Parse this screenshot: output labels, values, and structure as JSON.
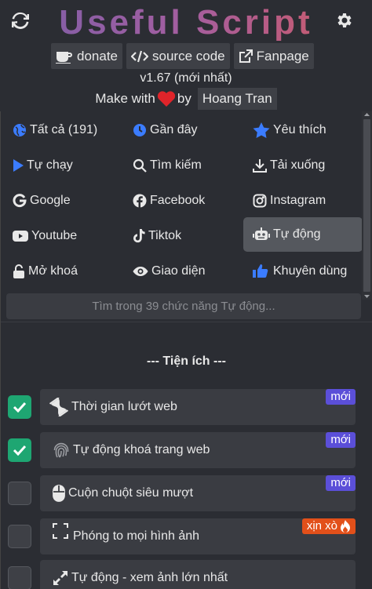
{
  "header": {
    "title": "Useful Script",
    "links": [
      {
        "label": "donate",
        "icon": "coffee-icon"
      },
      {
        "label": "source code",
        "icon": "code-icon"
      },
      {
        "label": "Fanpage",
        "icon": "external-link-icon"
      }
    ],
    "version": "v1.67 (mới nhất)",
    "made_with": "Make with",
    "by": "by",
    "author": "Hoang Tran"
  },
  "categories": [
    {
      "label": "Tất cả (191)",
      "icon": "globe-icon",
      "color": "#3b7cff"
    },
    {
      "label": "Gần đây",
      "icon": "clock-icon",
      "color": "#3b7cff"
    },
    {
      "label": "Yêu thích",
      "icon": "star-icon",
      "color": "#3b7cff"
    },
    {
      "label": "Tự chạy",
      "icon": "play-icon",
      "color": "#3b7cff"
    },
    {
      "label": "Tìm kiếm",
      "icon": "search-icon",
      "color": "#e8e8e8"
    },
    {
      "label": "Tải xuống",
      "icon": "download-icon",
      "color": "#e8e8e8"
    },
    {
      "label": "Google",
      "icon": "google-icon",
      "color": "#e8e8e8"
    },
    {
      "label": "Facebook",
      "icon": "facebook-icon",
      "color": "#e8e8e8"
    },
    {
      "label": "Instagram",
      "icon": "instagram-icon",
      "color": "#e8e8e8"
    },
    {
      "label": "Youtube",
      "icon": "youtube-icon",
      "color": "#e8e8e8"
    },
    {
      "label": "Tiktok",
      "icon": "tiktok-icon",
      "color": "#e8e8e8"
    },
    {
      "label": "Tự động",
      "icon": "robot-icon",
      "color": "#e8e8e8",
      "active": true
    },
    {
      "label": "Mở khoá",
      "icon": "unlock-icon",
      "color": "#e8e8e8"
    },
    {
      "label": "Giao diện",
      "icon": "eye-icon",
      "color": "#e8e8e8"
    },
    {
      "label": "Khuyên dùng",
      "icon": "thumbs-up-icon",
      "color": "#3b7cff"
    }
  ],
  "search": {
    "placeholder": "Tìm trong 39 chức năng Tự động..."
  },
  "section_title": "--- Tiện ích ---",
  "scripts": [
    {
      "label": "Thời gian lướt web",
      "icon": "hourglass-icon",
      "checked": true,
      "badge": "mới"
    },
    {
      "label": "Tự động khoá trang web",
      "icon": "fingerprint-icon",
      "checked": true,
      "badge": "mới"
    },
    {
      "label": "Cuộn chuột siêu mượt",
      "icon": "mouse-icon",
      "checked": false,
      "badge": "mới"
    },
    {
      "label": "Phóng to mọi hình ảnh",
      "icon": "expand-icon",
      "checked": false,
      "badge": "xịn xò",
      "badge_icon": "fire-icon"
    },
    {
      "label": "Tự động - xem ảnh lớn nhất",
      "icon": "arrows-expand-icon",
      "checked": false,
      "badge": ""
    }
  ],
  "colors": {
    "accent": "#3b7cff",
    "checked": "#1ea672",
    "badge_new": "#5b4fd8",
    "badge_hot": "#e2501a",
    "heart": "#e0242a"
  }
}
